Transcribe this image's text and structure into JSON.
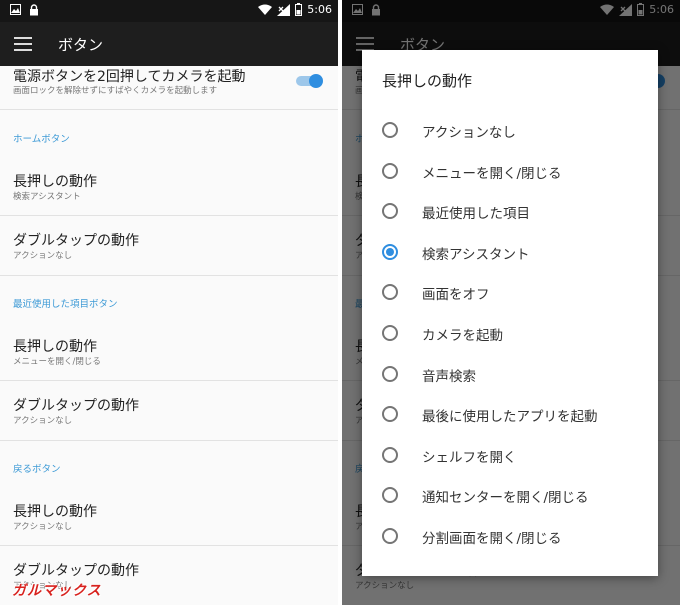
{
  "status": {
    "time": "5:06"
  },
  "appbar": {
    "title": "ボタン"
  },
  "settings": {
    "camera": {
      "title": "電源ボタンを2回押してカメラを起動",
      "subtitle": "画面ロックを解除せずにすばやくカメラを起動します",
      "enabled": true
    },
    "home_section": "ホームボタン",
    "home_long": {
      "title": "長押しの動作",
      "subtitle": "検索アシスタント"
    },
    "home_double": {
      "title": "ダブルタップの動作",
      "subtitle": "アクションなし"
    },
    "recent_section": "最近使用した項目ボタン",
    "recent_long": {
      "title": "長押しの動作",
      "subtitle": "メニューを開く/閉じる"
    },
    "recent_double": {
      "title": "ダブルタップの動作",
      "subtitle": "アクションなし"
    },
    "back_section": "戻るボタン",
    "back_long": {
      "title": "長押しの動作",
      "subtitle": "アクションなし"
    },
    "back_double": {
      "title": "ダブルタップの動作",
      "subtitle": "アクションなし"
    }
  },
  "dialog": {
    "title": "長押しの動作",
    "selected_index": 3,
    "options": [
      "アクションなし",
      "メニューを開く/閉じる",
      "最近使用した項目",
      "検索アシスタント",
      "画面をオフ",
      "カメラを起動",
      "音声検索",
      "最後に使用したアプリを起動",
      "シェルフを開く",
      "通知センターを開く/閉じる",
      "分割画面を開く/閉じる"
    ]
  },
  "watermark": "ガルマックス",
  "colors": {
    "accent": "#2f8ee0",
    "section": "#3d9ad6",
    "appbar": "#1e1e1e"
  }
}
